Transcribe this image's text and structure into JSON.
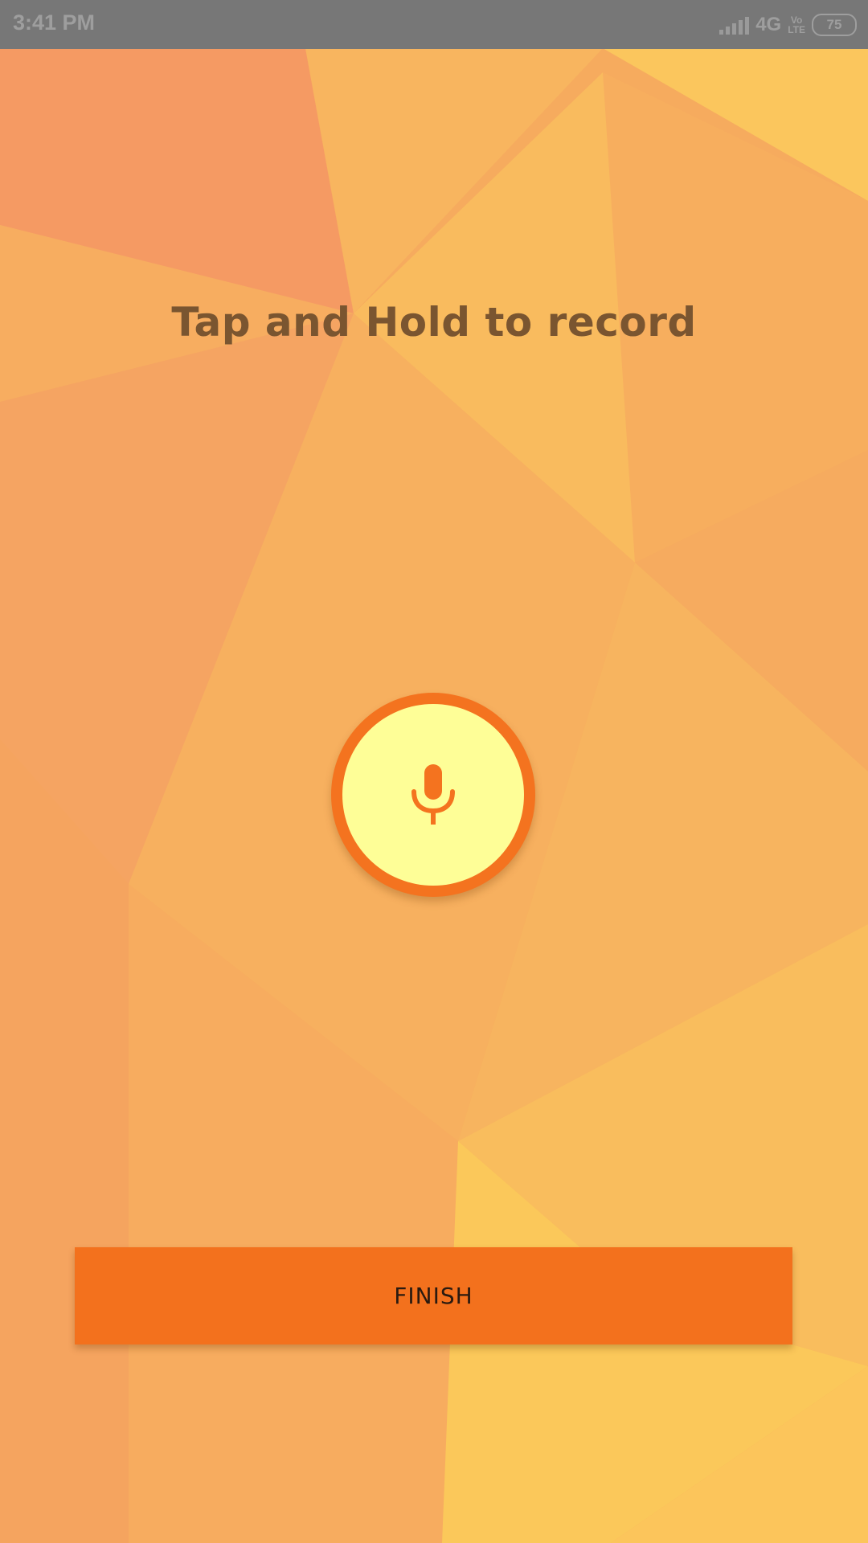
{
  "status_bar": {
    "time": "3:41 PM",
    "network": "4G",
    "volte_top": "Vo",
    "volte_bottom": "LTE",
    "battery": "75",
    "icons": [
      "signal-icon",
      "volte-icon",
      "battery-icon"
    ]
  },
  "main": {
    "instruction": "Tap and Hold to record",
    "record_button": {
      "icon": "microphone-icon"
    },
    "finish_button": {
      "label": "FINISH"
    }
  },
  "colors": {
    "status_bar": "#777777",
    "background_base": "#f6ad5f",
    "accent_orange": "#f4731f",
    "record_inner": "#fefe97",
    "instruction_text": "#7a5530",
    "finish_text": "#2a1a10"
  }
}
